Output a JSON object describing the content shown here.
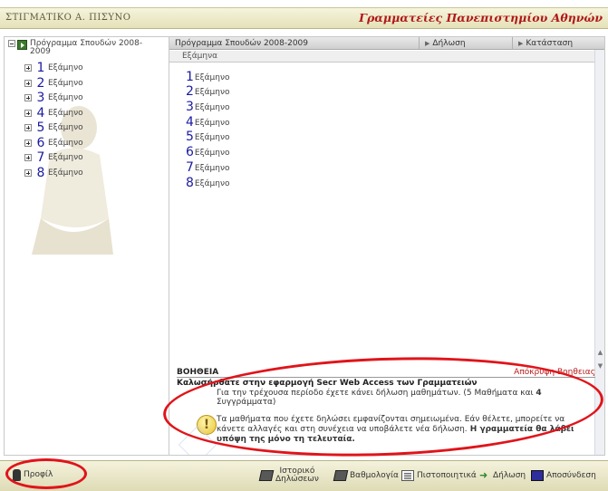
{
  "header": {
    "user_label": "ΣΤΙΓΜΑΤΙΚΟ Α. ΠΙΣΥΝΟ",
    "brand": "Γραμματείες Πανεπιστημίου Αθηνών"
  },
  "tree": {
    "root_label": "Πρόγραμμα Σπουδών 2008-2009",
    "items": [
      {
        "num": "1",
        "label": "Εξάμηνο"
      },
      {
        "num": "2",
        "label": "Εξάμηνο"
      },
      {
        "num": "3",
        "label": "Εξάμηνο"
      },
      {
        "num": "4",
        "label": "Εξάμηνο"
      },
      {
        "num": "5",
        "label": "Εξάμηνο"
      },
      {
        "num": "6",
        "label": "Εξάμηνο"
      },
      {
        "num": "7",
        "label": "Εξάμηνο"
      },
      {
        "num": "8",
        "label": "Εξάμηνο"
      }
    ]
  },
  "main": {
    "tabs": {
      "program": "Πρόγραμμα Σπουδών 2008-2009",
      "declaration": "Δήλωση",
      "status": "Κατάσταση"
    },
    "subtab": "Εξάμηνα",
    "semesters": [
      {
        "num": "1",
        "label": "Εξάμηνο"
      },
      {
        "num": "2",
        "label": "Εξάμηνο"
      },
      {
        "num": "3",
        "label": "Εξάμηνο"
      },
      {
        "num": "4",
        "label": "Εξάμηνο"
      },
      {
        "num": "5",
        "label": "Εξάμηνο"
      },
      {
        "num": "6",
        "label": "Εξάμηνο"
      },
      {
        "num": "7",
        "label": "Εξάμηνο"
      },
      {
        "num": "8",
        "label": "Εξάμηνο"
      }
    ]
  },
  "help": {
    "title": "ΒΟΗΘΕΙΑ",
    "hide_link": "Απόκρυψη Βοηθειας",
    "welcome": "Καλωσήρθατε στην εφαρμογή Secr Web Access των Γραμματειών",
    "line1_pre": "Για την τρέχουσα περίοδο έχετε κάνει δήλωση μαθημάτων. (",
    "courses": "5",
    "line1_mid": " Μαθήματα και ",
    "books": "4",
    "line1_post": " Συγγράμματα)",
    "line2_normal": "Τα μαθήματα που έχετε δηλώσει εμφανίζονται σημειωμένα. Εάν θέλετε, μπορείτε να κάνετε αλλαγές και στη συνέχεια να υποβάλετε νέα δήλωση.",
    "line2_bold": " Η γραμματεία θα λάβει υπόψη της μόνο τη τελευταία.",
    "warn_glyph": "!"
  },
  "footer": {
    "profile": "Προφίλ",
    "history_line1": "Ιστορικό",
    "history_line2": "Δηλώσεων",
    "grades": "Βαθμολογία",
    "certificates": "Πιστοποιητικά",
    "declaration": "Δήλωση",
    "logout": "Αποσύνδεση"
  },
  "colors": {
    "brand": "#b01818",
    "annotation": "#e0141a",
    "semester_number": "#1a1aa0"
  }
}
